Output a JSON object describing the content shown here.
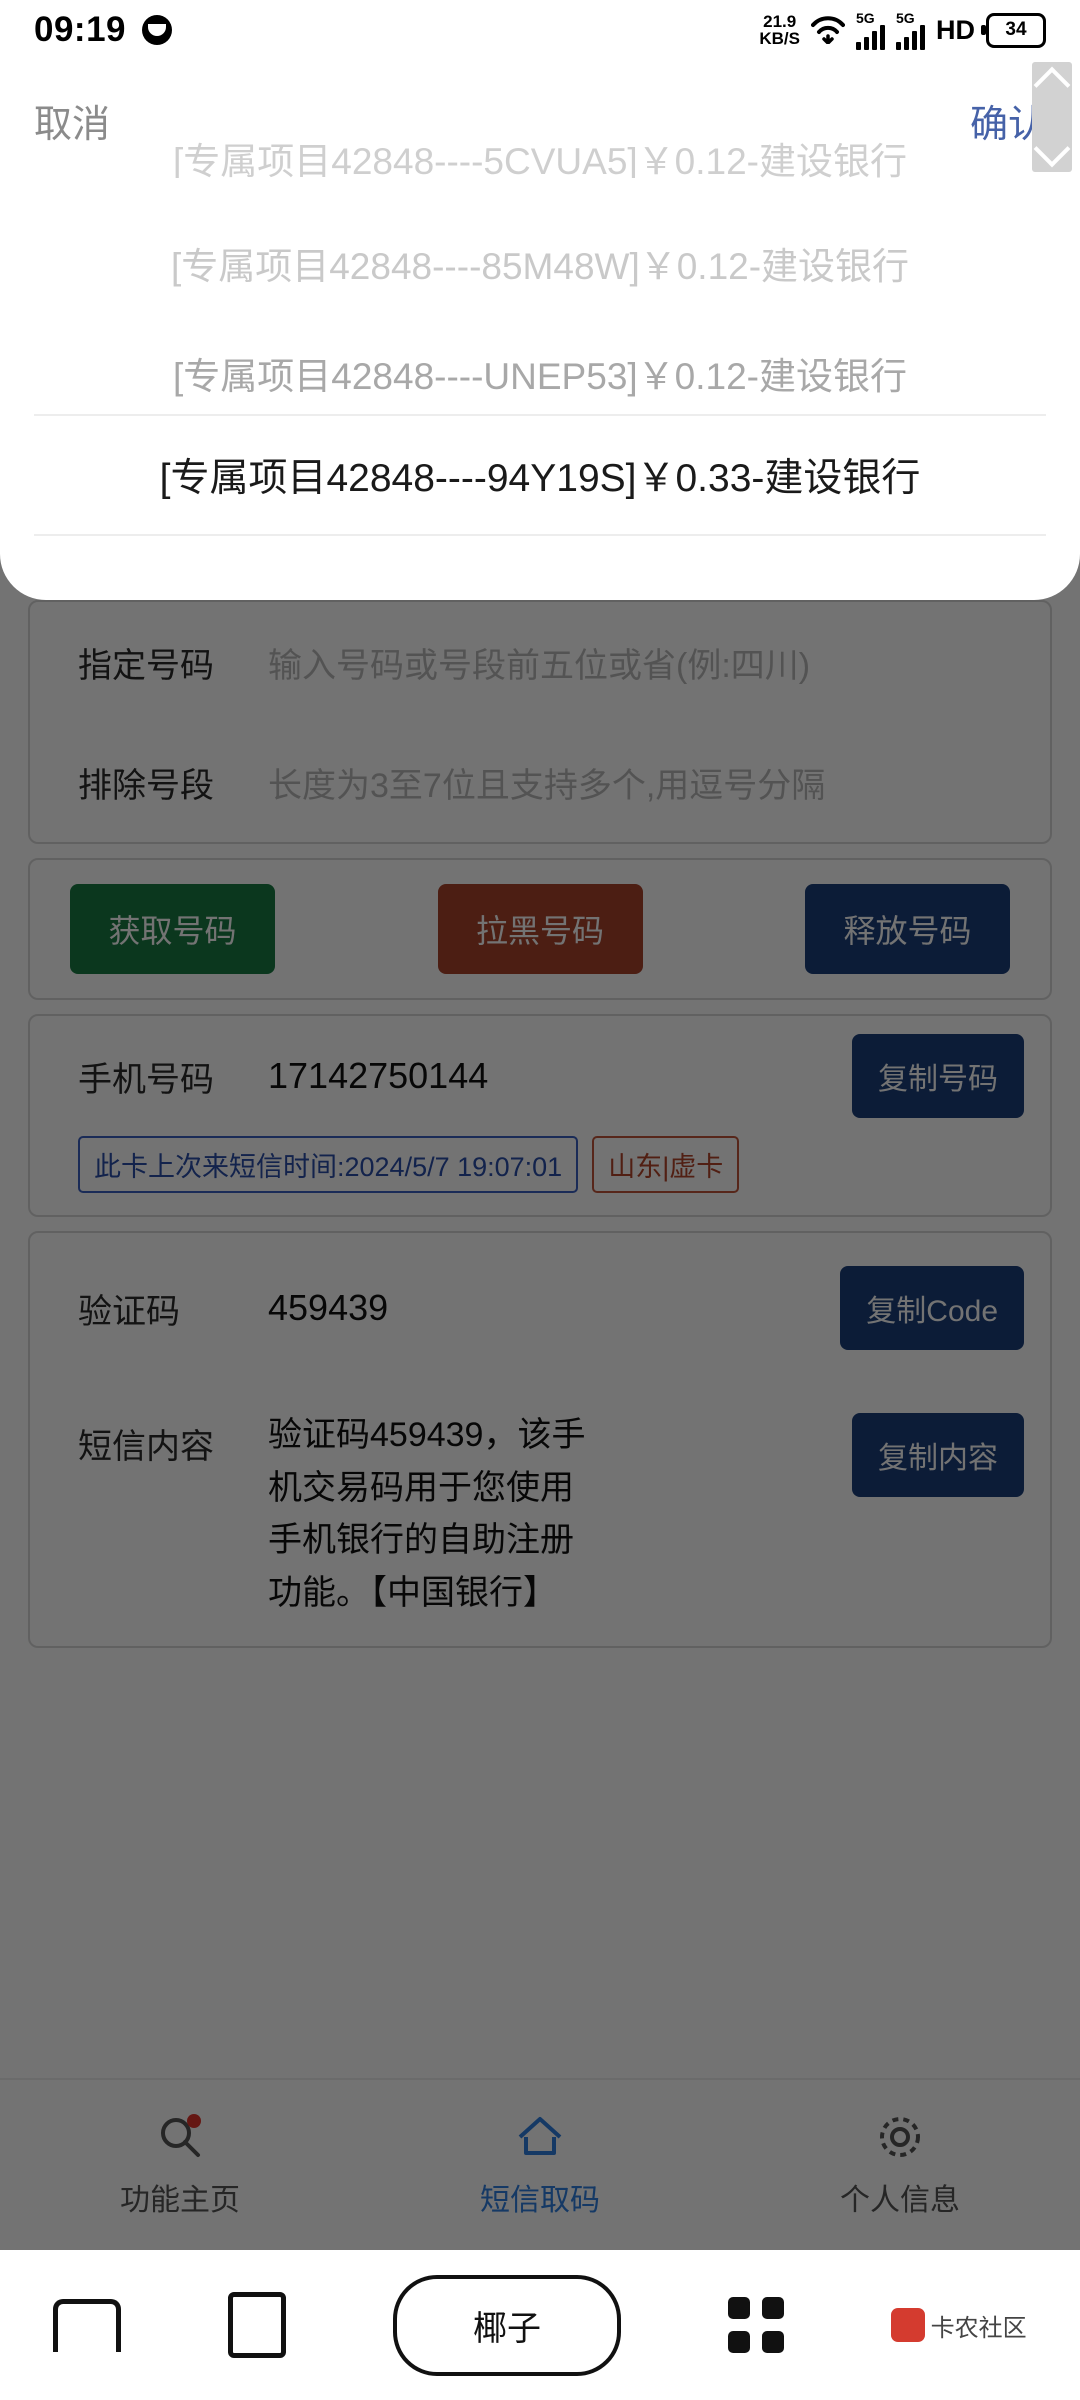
{
  "status_bar": {
    "time": "09:19",
    "app_icon": "drop-icon",
    "net_speed_value": "21.9",
    "net_speed_unit": "KB/S",
    "wifi_icon": "wifi-icon",
    "sim1_label": "5G",
    "sim2_label": "5G",
    "hd_label": "HD",
    "battery_percent": "34"
  },
  "picker_sheet": {
    "cancel_label": "取消",
    "confirm_label": "确认",
    "scroll_up_icon": "chevron-up-icon",
    "scroll_down_icon": "chevron-down-icon",
    "options": [
      {
        "text": "[专属项目42848----5CVUA5]￥0.12-建设银行",
        "state": "clipped"
      },
      {
        "text": "[专属项目42848----85M48W]￥0.12-建设银行",
        "state": "dim"
      },
      {
        "text": "[专属项目42848----UNEP53]￥0.12-建设银行",
        "state": "near"
      },
      {
        "text": "[专属项目42848----94Y19S]￥0.33-建设银行",
        "state": "selected"
      }
    ],
    "selected_value": "[专属项目42848----94Y19S]￥0.33-建设银行"
  },
  "app": {
    "filter_card": {
      "rows": [
        {
          "label": "指定号码",
          "placeholder": "输入号码或号段前五位或省(例:四川)",
          "value": ""
        },
        {
          "label": "排除号段",
          "placeholder": "长度为3至7位且支持多个,用逗号分隔",
          "value": ""
        }
      ]
    },
    "action_buttons": [
      {
        "label": "获取号码",
        "color": "#1a7a43",
        "name": "get-number-button"
      },
      {
        "label": "拉黑号码",
        "color": "#a8432c",
        "name": "blacklist-number-button"
      },
      {
        "label": "释放号码",
        "color": "#1b3f7a",
        "name": "release-number-button"
      }
    ],
    "phone_card": {
      "label": "手机号码",
      "value": "17142750144",
      "copy_button": "复制号码",
      "last_sms_tag": "此卡上次来短信时间:2024/5/7 19:07:01",
      "region_tag": "山东|虚卡"
    },
    "code_card": {
      "code_label": "验证码",
      "code_value": "459439",
      "copy_code_button": "复制Code",
      "sms_label": "短信内容",
      "sms_value": "验证码459439，该手机交易码用于您使用手机银行的自助注册功能。【中国银行】",
      "copy_sms_button": "复制内容"
    },
    "tabs": [
      {
        "label": "功能主页",
        "icon": "search-icon",
        "active": false,
        "badge": true
      },
      {
        "label": "短信取码",
        "icon": "home-icon",
        "active": true,
        "badge": false
      },
      {
        "label": "个人信息",
        "icon": "gear-icon",
        "active": false,
        "badge": false
      }
    ]
  },
  "nav_bar": {
    "home_icon": "home-icon",
    "recent_icon": "recents-icon",
    "pill_label": "椰子",
    "apps_icon": "apps-grid-icon",
    "watermark": "卡农社区"
  },
  "colors": {
    "accent_blue": "#4662a8",
    "green": "#1a7a43",
    "red": "#a8432c",
    "dark_blue": "#1b3f7a",
    "tab_active": "#2f7fe0"
  }
}
